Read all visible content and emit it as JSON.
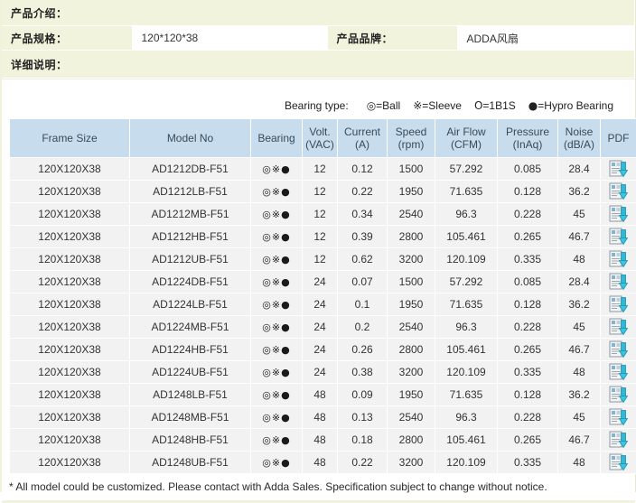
{
  "info": {
    "intro_label": "产品介绍：",
    "spec_label": "产品规格：",
    "spec_value": "120*120*38",
    "brand_label": "产品品牌：",
    "brand_value": "ADDA风扇",
    "detail_label": "详细说明："
  },
  "legend": {
    "title": "Bearing type:",
    "items": [
      {
        "symbol": "◎",
        "text": "=Ball"
      },
      {
        "symbol": "※",
        "text": "=Sleeve"
      },
      {
        "symbol": "O",
        "text": "=1B1S"
      },
      {
        "symbol": "●",
        "text": "=Hypro Bearing"
      }
    ]
  },
  "table": {
    "headers": [
      {
        "line1": "Frame Size",
        "line2": ""
      },
      {
        "line1": "Model No",
        "line2": ""
      },
      {
        "line1": "Bearing",
        "line2": ""
      },
      {
        "line1": "Volt.",
        "line2": "(VAC)"
      },
      {
        "line1": "Current",
        "line2": "(A)"
      },
      {
        "line1": "Speed",
        "line2": "(rpm)"
      },
      {
        "line1": "Air Flow",
        "line2": "(CFM)"
      },
      {
        "line1": "Pressure",
        "line2": "(InAq)"
      },
      {
        "line1": "Noise",
        "line2": "(dB/A)"
      },
      {
        "line1": "PDF",
        "line2": ""
      }
    ],
    "bearing_symbols": "◎※●",
    "pdf_icon": "pdf-download-icon",
    "rows": [
      {
        "frame": "120X120X38",
        "model": "AD1212DB-F51",
        "bearing": "◎※●",
        "volt": "12",
        "current": "0.12",
        "speed": "1500",
        "airflow": "57.292",
        "pressure": "0.085",
        "noise": "28.4"
      },
      {
        "frame": "120X120X38",
        "model": "AD1212LB-F51",
        "bearing": "◎※●",
        "volt": "12",
        "current": "0.22",
        "speed": "1950",
        "airflow": "71.635",
        "pressure": "0.128",
        "noise": "36.2"
      },
      {
        "frame": "120X120X38",
        "model": "AD1212MB-F51",
        "bearing": "◎※●",
        "volt": "12",
        "current": "0.34",
        "speed": "2540",
        "airflow": "96.3",
        "pressure": "0.228",
        "noise": "45"
      },
      {
        "frame": "120X120X38",
        "model": "AD1212HB-F51",
        "bearing": "◎※●",
        "volt": "12",
        "current": "0.39",
        "speed": "2800",
        "airflow": "105.461",
        "pressure": "0.265",
        "noise": "46.7"
      },
      {
        "frame": "120X120X38",
        "model": "AD1212UB-F51",
        "bearing": "◎※●",
        "volt": "12",
        "current": "0.62",
        "speed": "3200",
        "airflow": "120.109",
        "pressure": "0.335",
        "noise": "48"
      },
      {
        "frame": "120X120X38",
        "model": "AD1224DB-F51",
        "bearing": "◎※●",
        "volt": "24",
        "current": "0.07",
        "speed": "1500",
        "airflow": "57.292",
        "pressure": "0.085",
        "noise": "28.4"
      },
      {
        "frame": "120X120X38",
        "model": "AD1224LB-F51",
        "bearing": "◎※●",
        "volt": "24",
        "current": "0.1",
        "speed": "1950",
        "airflow": "71.635",
        "pressure": "0.128",
        "noise": "36.2"
      },
      {
        "frame": "120X120X38",
        "model": "AD1224MB-F51",
        "bearing": "◎※●",
        "volt": "24",
        "current": "0.2",
        "speed": "2540",
        "airflow": "96.3",
        "pressure": "0.228",
        "noise": "45"
      },
      {
        "frame": "120X120X38",
        "model": "AD1224HB-F51",
        "bearing": "◎※●",
        "volt": "24",
        "current": "0.26",
        "speed": "2800",
        "airflow": "105.461",
        "pressure": "0.265",
        "noise": "46.7"
      },
      {
        "frame": "120X120X38",
        "model": "AD1224UB-F51",
        "bearing": "◎※●",
        "volt": "24",
        "current": "0.38",
        "speed": "3200",
        "airflow": "120.109",
        "pressure": "0.335",
        "noise": "48"
      },
      {
        "frame": "120X120X38",
        "model": "AD1248LB-F51",
        "bearing": "◎※●",
        "volt": "48",
        "current": "0.09",
        "speed": "1950",
        "airflow": "71.635",
        "pressure": "0.128",
        "noise": "36.2"
      },
      {
        "frame": "120X120X38",
        "model": "AD1248MB-F51",
        "bearing": "◎※●",
        "volt": "48",
        "current": "0.13",
        "speed": "2540",
        "airflow": "96.3",
        "pressure": "0.228",
        "noise": "45"
      },
      {
        "frame": "120X120X38",
        "model": "AD1248HB-F51",
        "bearing": "◎※●",
        "volt": "48",
        "current": "0.18",
        "speed": "2800",
        "airflow": "105.461",
        "pressure": "0.265",
        "noise": "46.7"
      },
      {
        "frame": "120X120X38",
        "model": "AD1248UB-F51",
        "bearing": "◎※●",
        "volt": "48",
        "current": "0.22",
        "speed": "3200",
        "airflow": "120.109",
        "pressure": "0.335",
        "noise": "48"
      }
    ]
  },
  "footer": {
    "note": "* All model could be customized. Please contact with Adda Sales. Specification subject to change without notice."
  },
  "colors": {
    "banner_bg": "#f2f3dc",
    "header_bg": "#c7dcec",
    "row_bg": "#f2f2f2",
    "model_text": "#5a6b3a",
    "icon_accent": "#23b6d8"
  }
}
